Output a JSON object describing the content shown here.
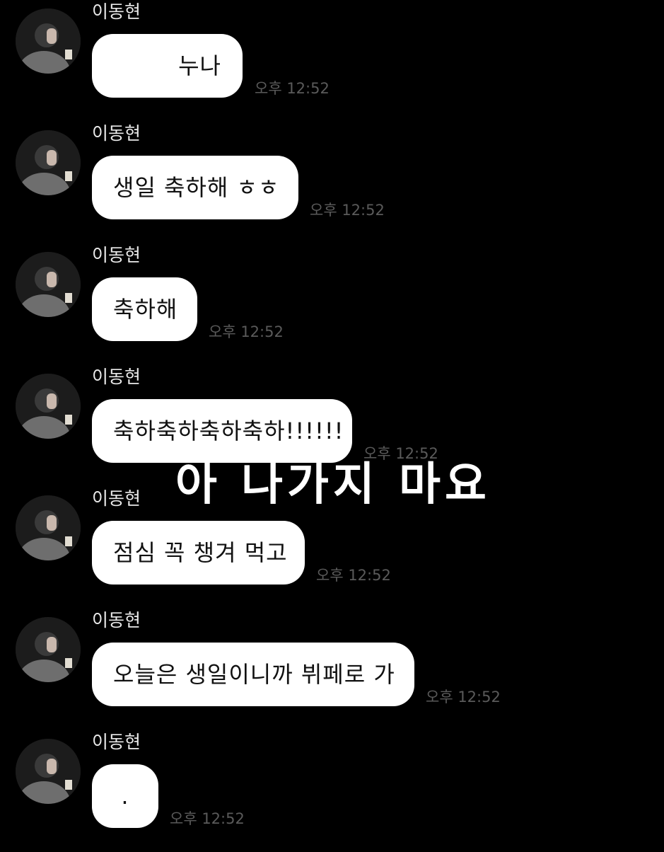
{
  "chat": {
    "avatar_icon": "profile-photo-avatar",
    "messages": [
      {
        "sender": "이동현",
        "text": "누나",
        "time": "오후 12:52"
      },
      {
        "sender": "이동현",
        "text": "생일 축하해 ㅎㅎ",
        "time": "오후 12:52"
      },
      {
        "sender": "이동현",
        "text": "축하해",
        "time": "오후 12:52"
      },
      {
        "sender": "이동현",
        "text": "축하축하축하축하!!!!!!",
        "time": "오후 12:52"
      },
      {
        "sender": "이동현",
        "text": "점심 꼭 챙겨 먹고",
        "time": "오후 12:52"
      },
      {
        "sender": "이동현",
        "text": "오늘은 생일이니까 뷔페로 가",
        "time": "오후 12:52"
      },
      {
        "sender": "이동현",
        "text": ".",
        "time": "오후 12:52"
      }
    ]
  },
  "overlay": {
    "caption": "아 나가지 마요"
  }
}
